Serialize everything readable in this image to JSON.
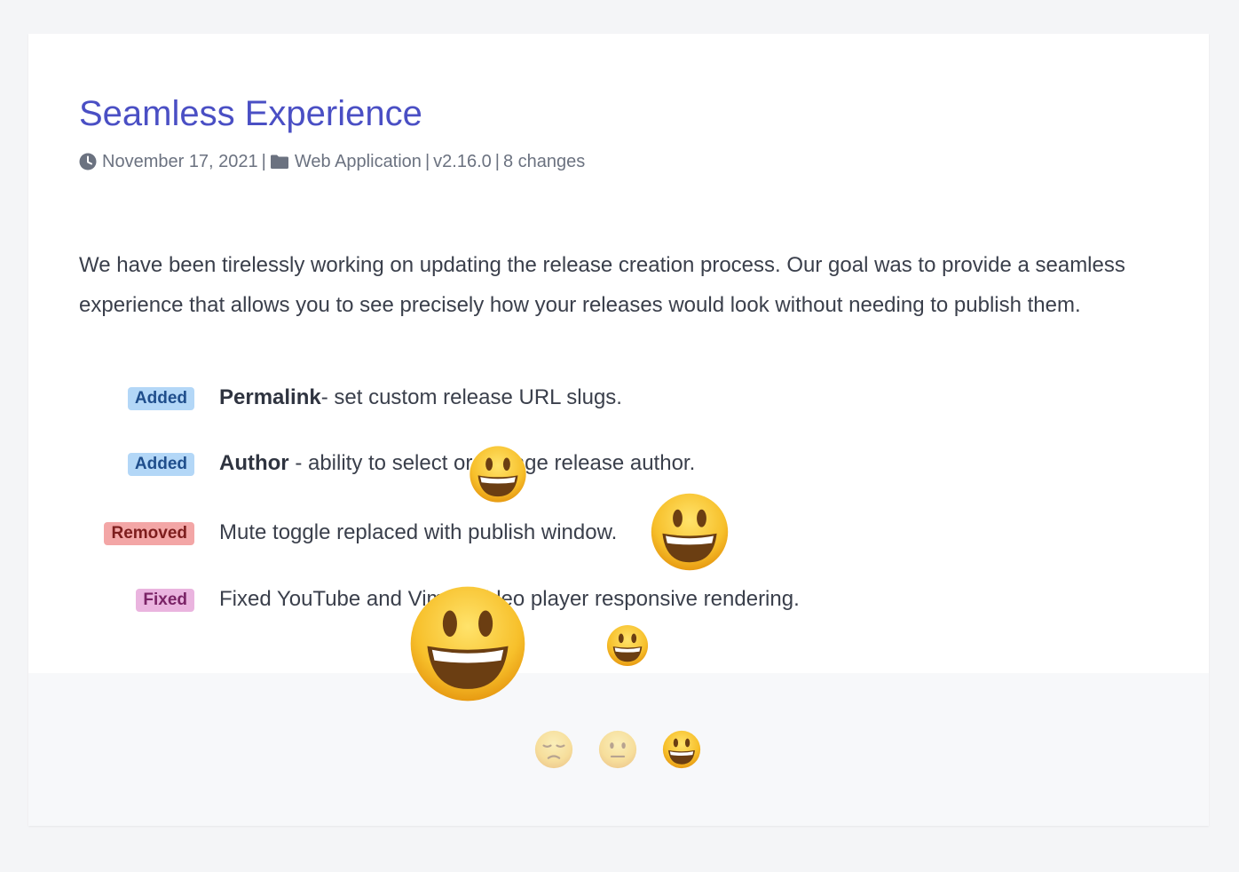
{
  "release": {
    "title": "Seamless Experience",
    "date": "November 17, 2021",
    "category": "Web Application",
    "version": "v2.16.0",
    "change_count": "8 changes",
    "separator": "|",
    "intro": "We have been tirelessly working on updating the release creation process. Our goal was to provide a seamless experience that allows you to see precisely how your releases would look without needing to publish them."
  },
  "changes": [
    {
      "tag": "Added",
      "tag_type": "added",
      "bold": "Permalink",
      "text": "- set custom release URL slugs."
    },
    {
      "tag": "Added",
      "tag_type": "added",
      "bold": "Author",
      "text": " - ability to select or change release author."
    },
    {
      "tag": "Removed",
      "tag_type": "removed",
      "bold": "",
      "text": "Mute toggle replaced with publish window."
    },
    {
      "tag": "Fixed",
      "tag_type": "fixed",
      "bold": "",
      "text": "Fixed YouTube and Vimeo video player responsive rendering."
    }
  ],
  "reactions": [
    {
      "name": "sad",
      "selected": false
    },
    {
      "name": "neutral",
      "selected": false
    },
    {
      "name": "happy",
      "selected": true
    }
  ],
  "icons": {
    "clock": "clock-icon",
    "folder": "folder-icon"
  },
  "colors": {
    "title": "#4a4fc4",
    "text": "#3a3f4b",
    "meta": "#6b7280",
    "added_bg": "#b3d7f7",
    "removed_bg": "#f3a6a6",
    "fixed_bg": "#eab4df",
    "emoji_face": "#f7c02b"
  }
}
